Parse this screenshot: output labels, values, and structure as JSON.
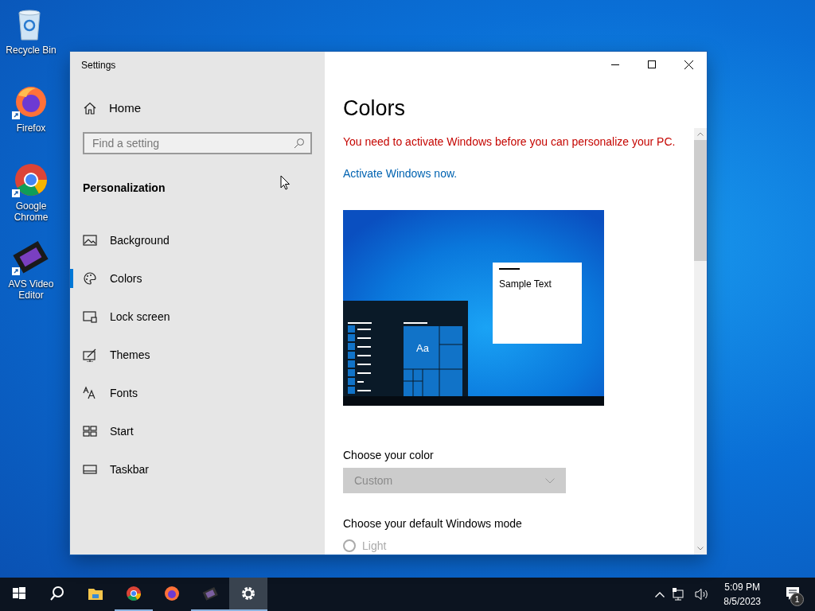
{
  "desktop_icons": [
    {
      "label": "Recycle Bin",
      "kind": "recycle"
    },
    {
      "label": "Firefox",
      "kind": "firefox"
    },
    {
      "label": "Google Chrome",
      "kind": "chrome"
    },
    {
      "label": "AVS Video Editor",
      "kind": "video"
    }
  ],
  "window": {
    "title": "Settings"
  },
  "sidebar": {
    "home": "Home",
    "search": {
      "placeholder": "Find a setting"
    },
    "section": "Personalization",
    "items": [
      {
        "label": "Background",
        "kind": "background",
        "selected": false
      },
      {
        "label": "Colors",
        "kind": "colors",
        "selected": true
      },
      {
        "label": "Lock screen",
        "kind": "lock",
        "selected": false
      },
      {
        "label": "Themes",
        "kind": "themes",
        "selected": false
      },
      {
        "label": "Fonts",
        "kind": "fonts",
        "selected": false
      },
      {
        "label": "Start",
        "kind": "start",
        "selected": false
      },
      {
        "label": "Taskbar",
        "kind": "taskbar",
        "selected": false
      }
    ]
  },
  "content": {
    "title": "Colors",
    "warning": "You need to activate Windows before you can personalize your PC.",
    "link": "Activate Windows now.",
    "preview": {
      "sample_text": "Sample Text",
      "tile_text": "Aa"
    },
    "color_label": "Choose your color",
    "color_select": {
      "value": "Custom",
      "disabled": true
    },
    "mode_label": "Choose your default Windows mode",
    "mode_options": [
      {
        "label": "Light",
        "selected": false
      }
    ]
  },
  "taskbar": {
    "apps": [
      {
        "kind": "start",
        "open": false,
        "selected": false
      },
      {
        "kind": "search",
        "open": false,
        "selected": false
      },
      {
        "kind": "explorer",
        "open": false,
        "selected": false
      },
      {
        "kind": "chrome",
        "open": true,
        "selected": false
      },
      {
        "kind": "firefox",
        "open": false,
        "selected": false
      },
      {
        "kind": "video",
        "open": true,
        "selected": false
      },
      {
        "kind": "settings",
        "open": true,
        "selected": true
      }
    ],
    "time": "5:09 PM",
    "date": "8/5/2023",
    "notifications": "1"
  }
}
